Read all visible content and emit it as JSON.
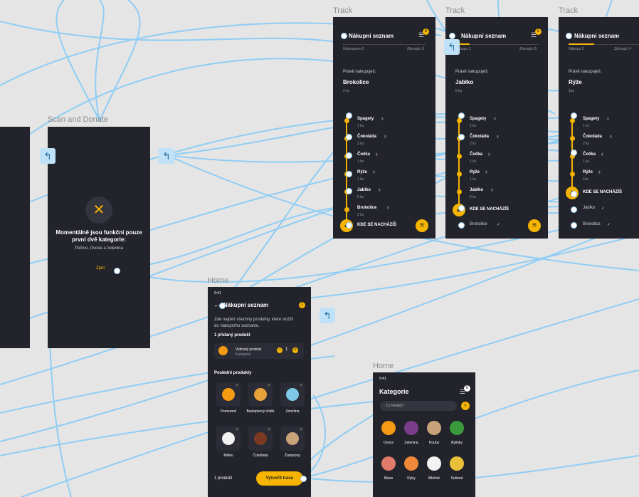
{
  "frames": {
    "track1": {
      "label": "Track",
      "title": "Nákupní seznam",
      "left_sub": "Nakoupeno 0",
      "right_sub": "Zbývající 6",
      "now_label": "Právě nakupuješ:",
      "now_item": "Brokolice",
      "now_qty": "2 ks",
      "items": [
        {
          "name": "Spagety",
          "qty": "1 ks"
        },
        {
          "name": "Čokoláda",
          "qty": "2 ks"
        },
        {
          "name": "Čočka",
          "qty": "1 ks"
        },
        {
          "name": "Rýže",
          "qty": "1 ks"
        },
        {
          "name": "Jablko",
          "qty": "6 ks"
        },
        {
          "name": "Brokolice",
          "qty": "2 ks"
        }
      ],
      "where": "KDE SE NACHÁZÍŠ"
    },
    "track2": {
      "label": "Track",
      "title": "Nákupní seznam",
      "left_sub": "Nákupu 1",
      "right_sub": "Zbývající 5",
      "now_label": "Právě nakupuješ:",
      "now_item": "Jablko",
      "now_qty": "6 ks",
      "items": [
        {
          "name": "Spagety",
          "qty": "1 ks"
        },
        {
          "name": "Čokoláda",
          "qty": "2 ks"
        },
        {
          "name": "Čočka",
          "qty": "1 ks"
        },
        {
          "name": "Rýže",
          "qty": "1 ks"
        },
        {
          "name": "Jablko",
          "qty": "6 ks"
        }
      ],
      "where": "KDE SE NACHÁZÍŠ",
      "done_item": "Brokolice"
    },
    "track3": {
      "label": "Track",
      "title": "Nákupní seznam",
      "left_sub": "Nákupu 2",
      "right_sub": "Zbývající 4",
      "now_label": "Právě nakupuješ:",
      "now_item": "Rýže",
      "now_qty": "1ks",
      "items": [
        {
          "name": "Spagety",
          "qty": "1 ks"
        },
        {
          "name": "Čokoláda",
          "qty": "2 ks"
        },
        {
          "name": "Čočka",
          "qty": "1 ks"
        },
        {
          "name": "Rýže",
          "qty": "1ks"
        }
      ],
      "where": "KDE SE NACHÁZÍŠ",
      "done_items": [
        "Jablko",
        "Brokolice"
      ]
    },
    "scan": {
      "label": "Scan and Donate",
      "message": "Momentálně jsou funkční pouze první dvě kategorie:",
      "categories": "Pečivo, Ovoce a zelenina",
      "back": "Zpět"
    },
    "home_list": {
      "label": "Home",
      "time": "9:41",
      "title": "Nákupní seznam",
      "badge": "1",
      "intro": "Zde najdeš všechny produkty, které vložíš do nákupního seznamu.",
      "added_heading": "1 přidaný produkt",
      "added_item": "Vybraný produkt",
      "added_sub": "Kategorie",
      "qty": "1",
      "recent_heading": "Poslední produkty",
      "products": [
        {
          "name": "Pomeranč",
          "color": "#f59a12"
        },
        {
          "name": "Bezlepkový chléb",
          "color": "#e8a23a"
        },
        {
          "name": "Zmrzlina",
          "color": "#7ec8e8"
        },
        {
          "name": "Mléko",
          "color": "#f2f2f2"
        },
        {
          "name": "Čokoláda",
          "color": "#7a3b22"
        },
        {
          "name": "Žampiony",
          "color": "#c9a27a"
        }
      ],
      "count": "1 produkt",
      "cta": "Vytvořit trasu"
    },
    "home_cat": {
      "label": "Home",
      "time": "9:41",
      "title": "Kategorie",
      "badge": "0",
      "search_placeholder": "Co hledáš?",
      "cats": [
        {
          "name": "Ovoce",
          "color": "#f59a12"
        },
        {
          "name": "Zelenina",
          "color": "#7a3d8a"
        },
        {
          "name": "Houby",
          "color": "#c9a27a"
        },
        {
          "name": "Bylinky",
          "color": "#3b9a3b"
        },
        {
          "name": "Maso",
          "color": "#e07a6a"
        },
        {
          "name": "Ryby",
          "color": "#f08a3a"
        },
        {
          "name": "Mléčné",
          "color": "#f2f2f2"
        },
        {
          "name": "Sušené",
          "color": "#e8c03a"
        }
      ]
    }
  },
  "colors": {
    "accent": "#f5b400",
    "frame_bg": "#22232b",
    "canvas_bg": "#e5e5e5",
    "wire": "#8fcdf4"
  }
}
